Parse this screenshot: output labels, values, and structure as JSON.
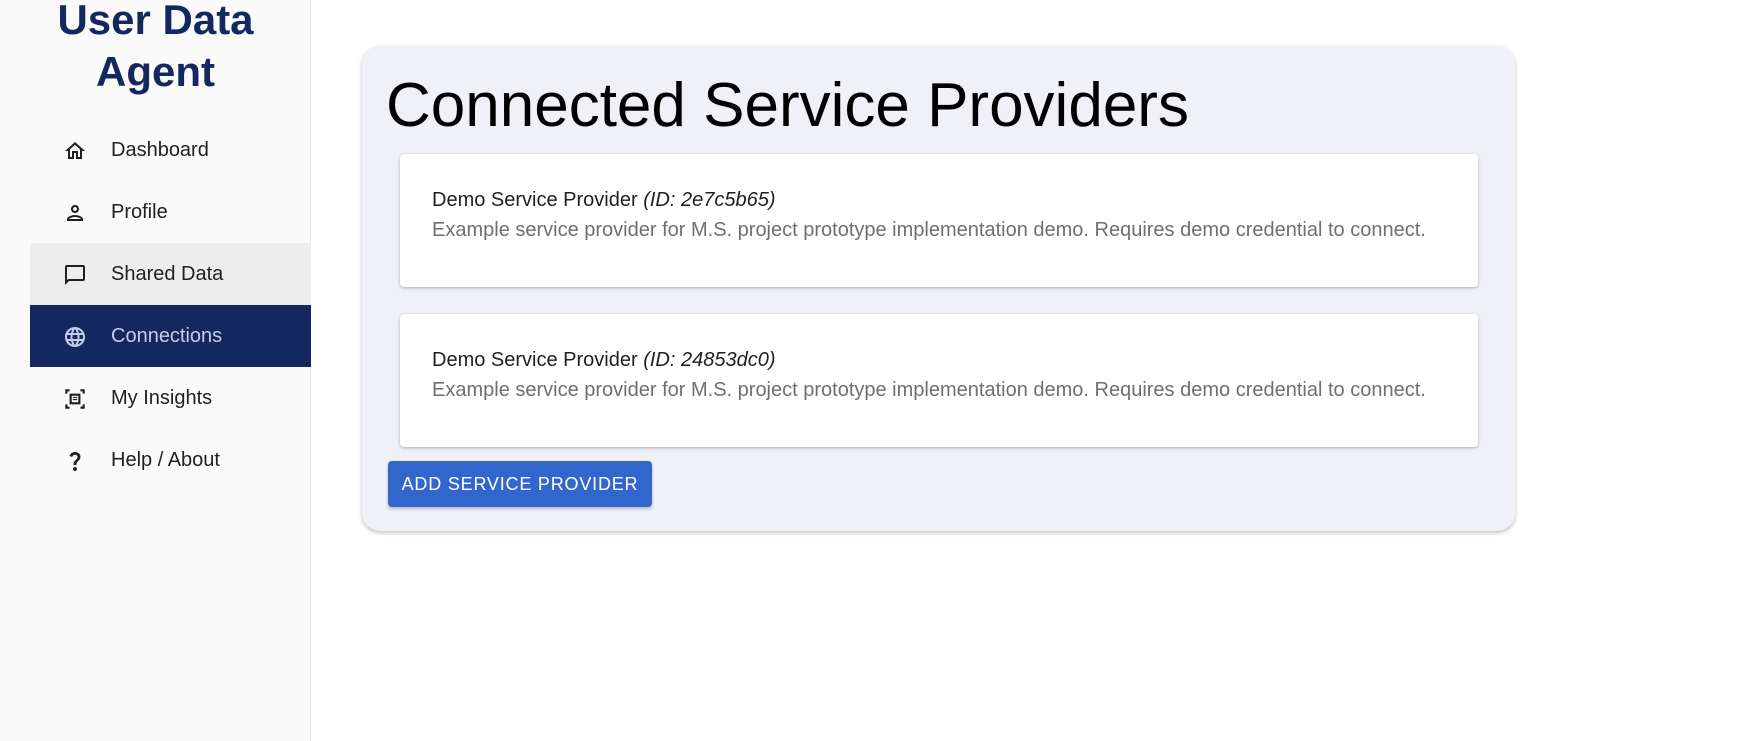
{
  "app": {
    "title": "User Data Agent"
  },
  "sidebar": {
    "items": [
      {
        "label": "Dashboard",
        "icon": "home-icon",
        "state": "normal"
      },
      {
        "label": "Profile",
        "icon": "person-icon",
        "state": "normal"
      },
      {
        "label": "Shared Data",
        "icon": "chat-icon",
        "state": "hover"
      },
      {
        "label": "Connections",
        "icon": "globe-icon",
        "state": "active"
      },
      {
        "label": "My Insights",
        "icon": "document-scan-icon",
        "state": "normal"
      },
      {
        "label": "Help / About",
        "icon": "help-icon",
        "state": "normal"
      }
    ]
  },
  "main": {
    "title": "Connected Service Providers",
    "providers": [
      {
        "name": "Demo Service Provider",
        "id_text": "(ID: 2e7c5b65)",
        "description": "Example service provider for M.S. project prototype implementation demo. Requires demo credential to connect."
      },
      {
        "name": "Demo Service Provider",
        "id_text": "(ID: 24853dc0)",
        "description": "Example service provider for M.S. project prototype implementation demo. Requires demo credential to connect."
      }
    ],
    "add_button_label": "ADD SERVICE PROVIDER"
  },
  "colors": {
    "brand": "#14285f",
    "button": "#3366cc",
    "panel_bg": "#f0f1f6",
    "sidebar_bg": "#fafafa"
  }
}
